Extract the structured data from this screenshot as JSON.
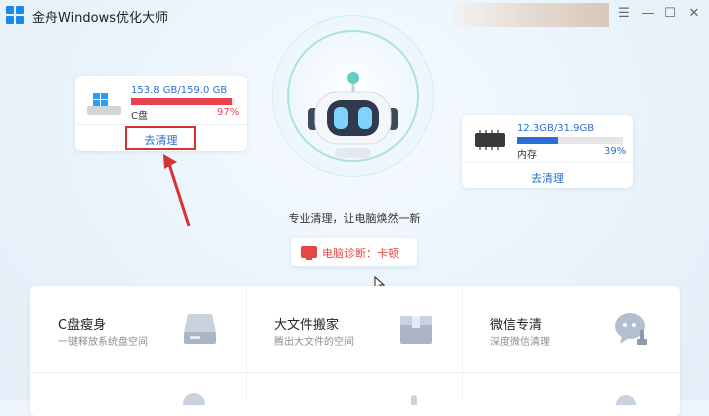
{
  "app": {
    "title": "金舟Windows优化大师"
  },
  "window_controls": {
    "menu": "☰",
    "minimize": "—",
    "maximize": "☐",
    "close": "✕"
  },
  "drive": {
    "usage_text": "153.8 GB/159.0 GB",
    "label": "C盘",
    "percent_text": "97%",
    "percent": 97,
    "action": "去清理",
    "bar_color": "#e8434f"
  },
  "memory": {
    "usage_text": "12.3GB/31.9GB",
    "label": "内存",
    "percent_text": "39%",
    "percent": 39,
    "action": "去清理",
    "bar_color": "#2a6fd6"
  },
  "tagline": "专业清理，让电脑焕然一新",
  "diagnosis": {
    "label": "电脑诊断：卡顿",
    "icon": "monitor-alert-icon"
  },
  "tiles": [
    {
      "title": "C盘瘦身",
      "desc": "一键释放系统盘空间",
      "icon": "disk-icon"
    },
    {
      "title": "大文件搬家",
      "desc": "腾出大文件的空间",
      "icon": "box-icon"
    },
    {
      "title": "微信专清",
      "desc": "深度微信清理",
      "icon": "chat-broom-icon"
    }
  ],
  "colors": {
    "accent": "#2a6fd6",
    "danger": "#e8434f",
    "highlight": "#d63333"
  }
}
